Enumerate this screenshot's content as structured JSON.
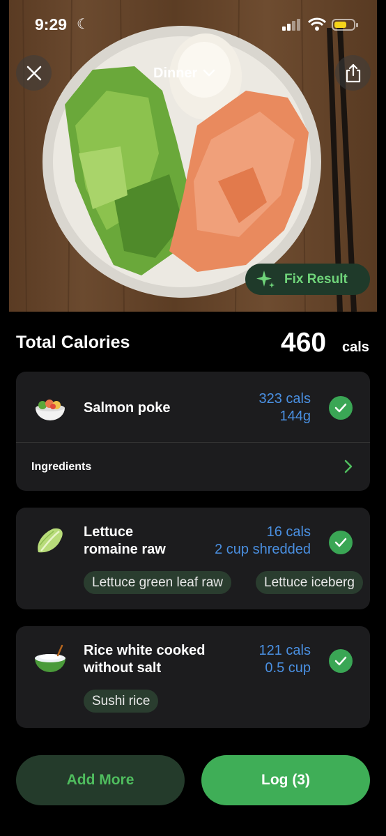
{
  "status_bar": {
    "time": "9:29"
  },
  "header": {
    "meal": "Dinner"
  },
  "photo_actions": {
    "fix_label": "Fix Result"
  },
  "summary": {
    "label": "Total Calories",
    "value": "460",
    "unit": "cals"
  },
  "items": [
    {
      "name": "Salmon poke",
      "calories": "323 cals",
      "amount": "144g",
      "icon": "poke-bowl-icon",
      "ingredients_label": "Ingredients"
    },
    {
      "name_line1": "Lettuce",
      "name_line2": "romaine raw",
      "calories": "16 cals",
      "amount": "2 cup shredded",
      "icon": "lettuce-icon",
      "alternatives": [
        "Lettuce green leaf raw",
        "Lettuce iceberg"
      ]
    },
    {
      "name_line1": "Rice white cooked",
      "name_line2": "without salt",
      "calories": "121 cals",
      "amount": "0.5 cup",
      "icon": "rice-bowl-icon",
      "alternatives": [
        "Sushi rice"
      ]
    }
  ],
  "actions": {
    "add_more": "Add More",
    "log": "Log (3)"
  },
  "colors": {
    "accent_green": "#3fae57",
    "calorie_blue": "#4a90e2",
    "card_bg": "#1c1c1e"
  }
}
